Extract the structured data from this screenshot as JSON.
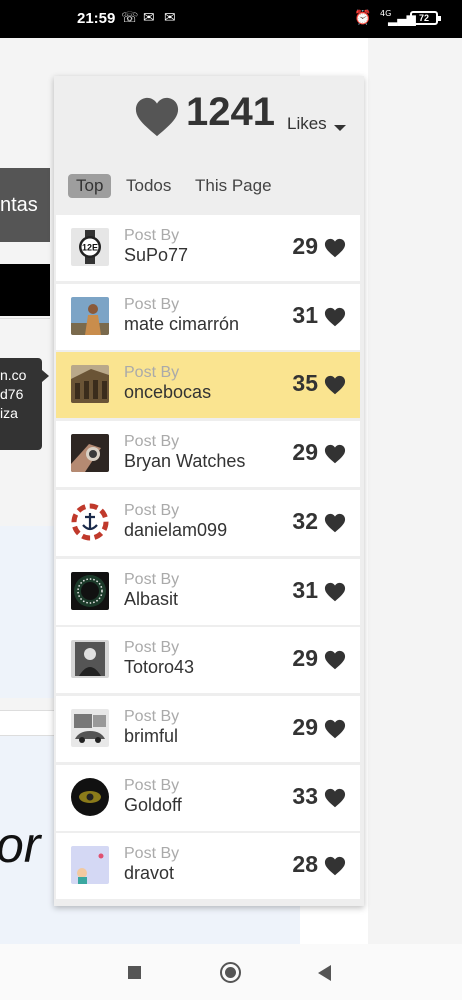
{
  "status_bar": {
    "time": "21:59",
    "network": "4G",
    "battery": "72"
  },
  "background": {
    "button_fragment": "ntas",
    "tooltip_lines": [
      "n.co",
      "d76",
      "iza"
    ],
    "big_text_fragment": "or"
  },
  "likes": {
    "count": "1241",
    "label": "Likes",
    "tabs": [
      "Top",
      "Todos",
      "This Page"
    ],
    "active_tab": "Top",
    "post_by_label": "Post By",
    "entries": [
      {
        "user": "SuPo77",
        "count": "29",
        "avatar": "watch-12-avatar"
      },
      {
        "user": "mate cimarrón",
        "count": "31",
        "avatar": "person-avatar"
      },
      {
        "user": "oncebocas",
        "count": "35",
        "avatar": "building-avatar",
        "highlight": true
      },
      {
        "user": "Bryan Watches",
        "count": "29",
        "avatar": "wrist-avatar"
      },
      {
        "user": "danielam099",
        "count": "32",
        "avatar": "anchor-avatar"
      },
      {
        "user": "Albasit",
        "count": "31",
        "avatar": "bezel-avatar"
      },
      {
        "user": "Totoro43",
        "count": "29",
        "avatar": "portrait-avatar"
      },
      {
        "user": "brimful",
        "count": "29",
        "avatar": "car-avatar"
      },
      {
        "user": "Goldoff",
        "count": "33",
        "avatar": "eye-avatar"
      },
      {
        "user": "dravot",
        "count": "28",
        "avatar": "cartoon-avatar"
      }
    ]
  },
  "colors": {
    "highlight": "#fae490",
    "active_tab": "#9e9e9e",
    "heart": "#333333"
  }
}
